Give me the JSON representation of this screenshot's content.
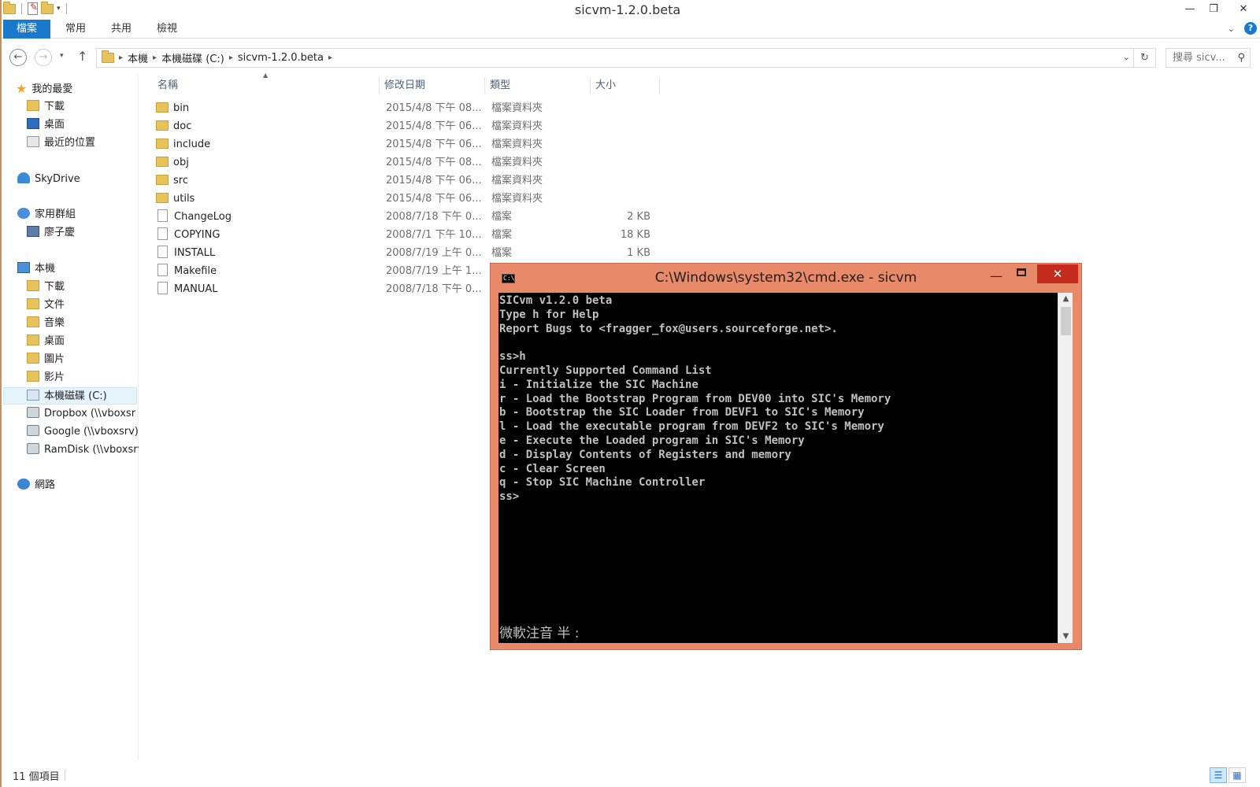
{
  "explorer": {
    "title": "sicvm-1.2.0.beta",
    "ribbon_tabs": [
      "檔案",
      "常用",
      "共用",
      "檢視"
    ],
    "breadcrumb": [
      "本機",
      "本機磁碟 (C:)",
      "sicvm-1.2.0.beta"
    ],
    "search_placeholder": "搜尋 sicv...",
    "nav_pane": {
      "favorites": {
        "label": "我的最愛",
        "items": [
          "下載",
          "桌面",
          "最近的位置"
        ]
      },
      "skydrive": "SkyDrive",
      "homegroup": {
        "label": "家用群組",
        "items": [
          "廖子慶"
        ]
      },
      "this_pc": {
        "label": "本機",
        "items": [
          "下載",
          "文件",
          "音樂",
          "桌面",
          "圖片",
          "影片",
          "本機磁碟 (C:)",
          "Dropbox (\\\\vboxsr",
          "Google (\\\\vboxsrv)",
          "RamDisk (\\\\vboxsrv"
        ]
      },
      "network": "網路"
    },
    "columns": {
      "name": "名稱",
      "date": "修改日期",
      "type": "類型",
      "size": "大小"
    },
    "files": [
      {
        "name": "bin",
        "date": "2015/4/8 下午 08...",
        "type": "檔案資料夾",
        "size": "",
        "kind": "folder"
      },
      {
        "name": "doc",
        "date": "2015/4/8 下午 06...",
        "type": "檔案資料夾",
        "size": "",
        "kind": "folder"
      },
      {
        "name": "include",
        "date": "2015/4/8 下午 06...",
        "type": "檔案資料夾",
        "size": "",
        "kind": "folder"
      },
      {
        "name": "obj",
        "date": "2015/4/8 下午 08...",
        "type": "檔案資料夾",
        "size": "",
        "kind": "folder"
      },
      {
        "name": "src",
        "date": "2015/4/8 下午 06...",
        "type": "檔案資料夾",
        "size": "",
        "kind": "folder"
      },
      {
        "name": "utils",
        "date": "2015/4/8 下午 06...",
        "type": "檔案資料夾",
        "size": "",
        "kind": "folder"
      },
      {
        "name": "ChangeLog",
        "date": "2008/7/18 下午 0...",
        "type": "檔案",
        "size": "2 KB",
        "kind": "file"
      },
      {
        "name": "COPYING",
        "date": "2008/7/1 下午 10...",
        "type": "檔案",
        "size": "18 KB",
        "kind": "file"
      },
      {
        "name": "INSTALL",
        "date": "2008/7/19 上午 0...",
        "type": "檔案",
        "size": "1 KB",
        "kind": "file"
      },
      {
        "name": "Makefile",
        "date": "2008/7/19 上午 1...",
        "type": "",
        "size": "",
        "kind": "file"
      },
      {
        "name": "MANUAL",
        "date": "2008/7/18 下午 0...",
        "type": "",
        "size": "",
        "kind": "file"
      }
    ],
    "status": "11 個項目"
  },
  "cmd": {
    "title": "C:\\Windows\\system32\\cmd.exe - sicvm",
    "lines": [
      "SICvm v1.2.0 beta",
      "Type h for Help",
      "Report Bugs to <fragger_fox@users.sourceforge.net>.",
      "",
      "ss>h",
      "Currently Supported Command List",
      "i - Initialize the SIC Machine",
      "r - Load the Bootstrap Program from DEV00 into SIC's Memory",
      "b - Bootstrap the SIC Loader from DEVF1 to SIC's Memory",
      "l - Load the executable program from DEVF2 to SIC's Memory",
      "e - Execute the Loaded program in SIC's Memory",
      "d - Display Contents of Registers and memory",
      "c - Clear Screen",
      "q - Stop SIC Machine Controller",
      "ss>"
    ],
    "ime_status": "微軟注音 半 :"
  }
}
